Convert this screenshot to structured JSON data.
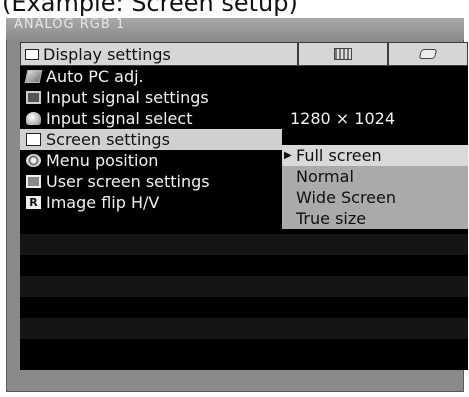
{
  "caption": "(Example: Screen setup)",
  "source": {
    "label": "ANALOG RGB 1"
  },
  "tabs": {
    "main_label": "Display settings",
    "tab_a_icon": "grid-icon",
    "tab_b_icon": "disk-icon"
  },
  "menu": {
    "items": [
      {
        "label": "Auto PC adj.",
        "icon": "auto-pc-icon"
      },
      {
        "label": "Input signal settings",
        "icon": "input-signal-icon"
      },
      {
        "label": "Input signal select",
        "icon": "signal-select-icon"
      },
      {
        "label": "Screen settings",
        "icon": "screen-icon",
        "selected": true
      },
      {
        "label": "Menu position",
        "icon": "menu-position-icon"
      },
      {
        "label": "User screen settings",
        "icon": "user-screen-icon"
      },
      {
        "label": "Image flip H/V",
        "icon": "image-flip-icon"
      }
    ],
    "current_value": "1280 × 1024",
    "submenu_options": [
      "Full screen",
      "Normal",
      "Wide Screen",
      "True size"
    ],
    "submenu_selected": "Full screen",
    "flip_icon_glyph": "R"
  }
}
